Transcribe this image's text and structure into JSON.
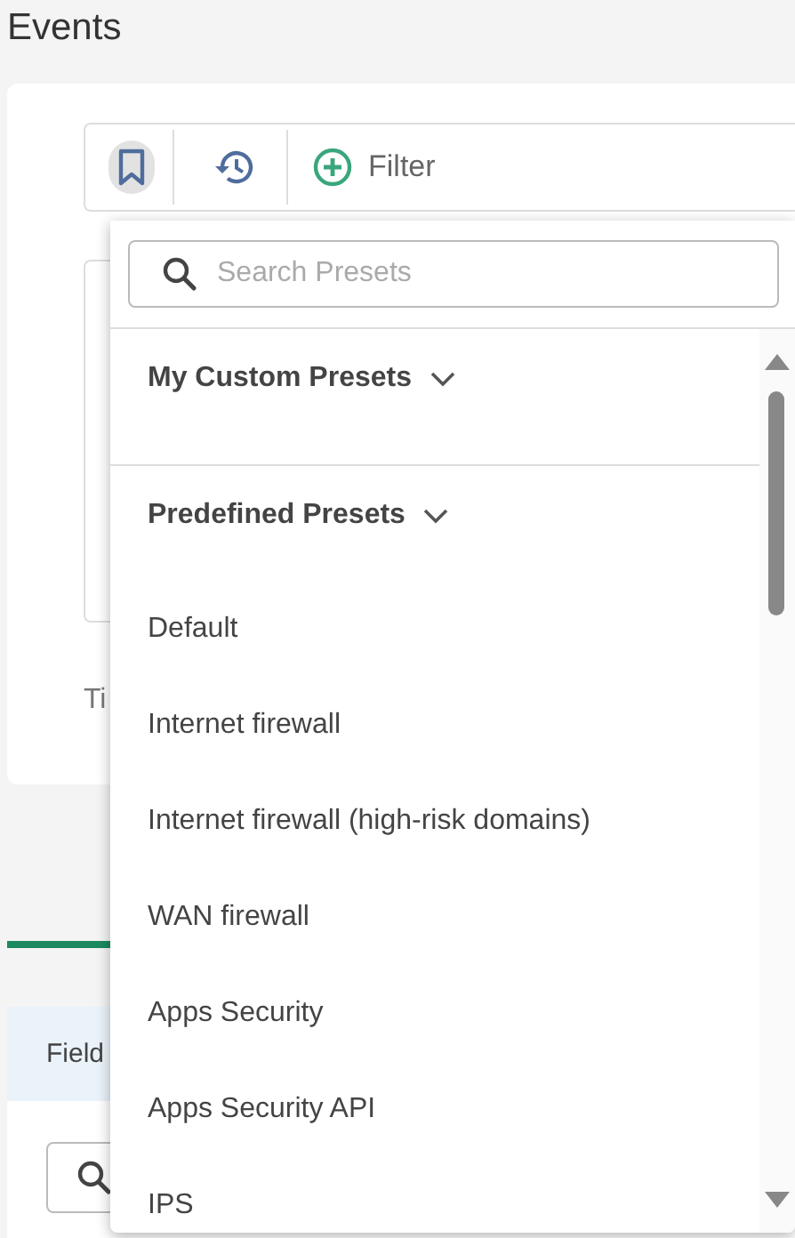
{
  "page": {
    "title": "Events"
  },
  "toolbar": {
    "buttons": [
      {
        "kind": "bookmark",
        "selected": true
      },
      {
        "kind": "history",
        "selected": false
      },
      {
        "kind": "filter",
        "label": "Filter",
        "selected": false
      }
    ]
  },
  "time_label": "Ti",
  "fields_bar": {
    "label": "Field"
  },
  "preset_menu": {
    "search": {
      "placeholder": "Search Presets"
    },
    "sections": [
      {
        "title": "My Custom Presets",
        "expanded": true
      },
      {
        "title": "Predefined Presets",
        "expanded": true,
        "items": [
          "Default",
          "Internet firewall",
          "Internet firewall (high-risk domains)",
          "WAN firewall",
          "Apps Security",
          "Apps Security API",
          "IPS"
        ]
      }
    ]
  }
}
